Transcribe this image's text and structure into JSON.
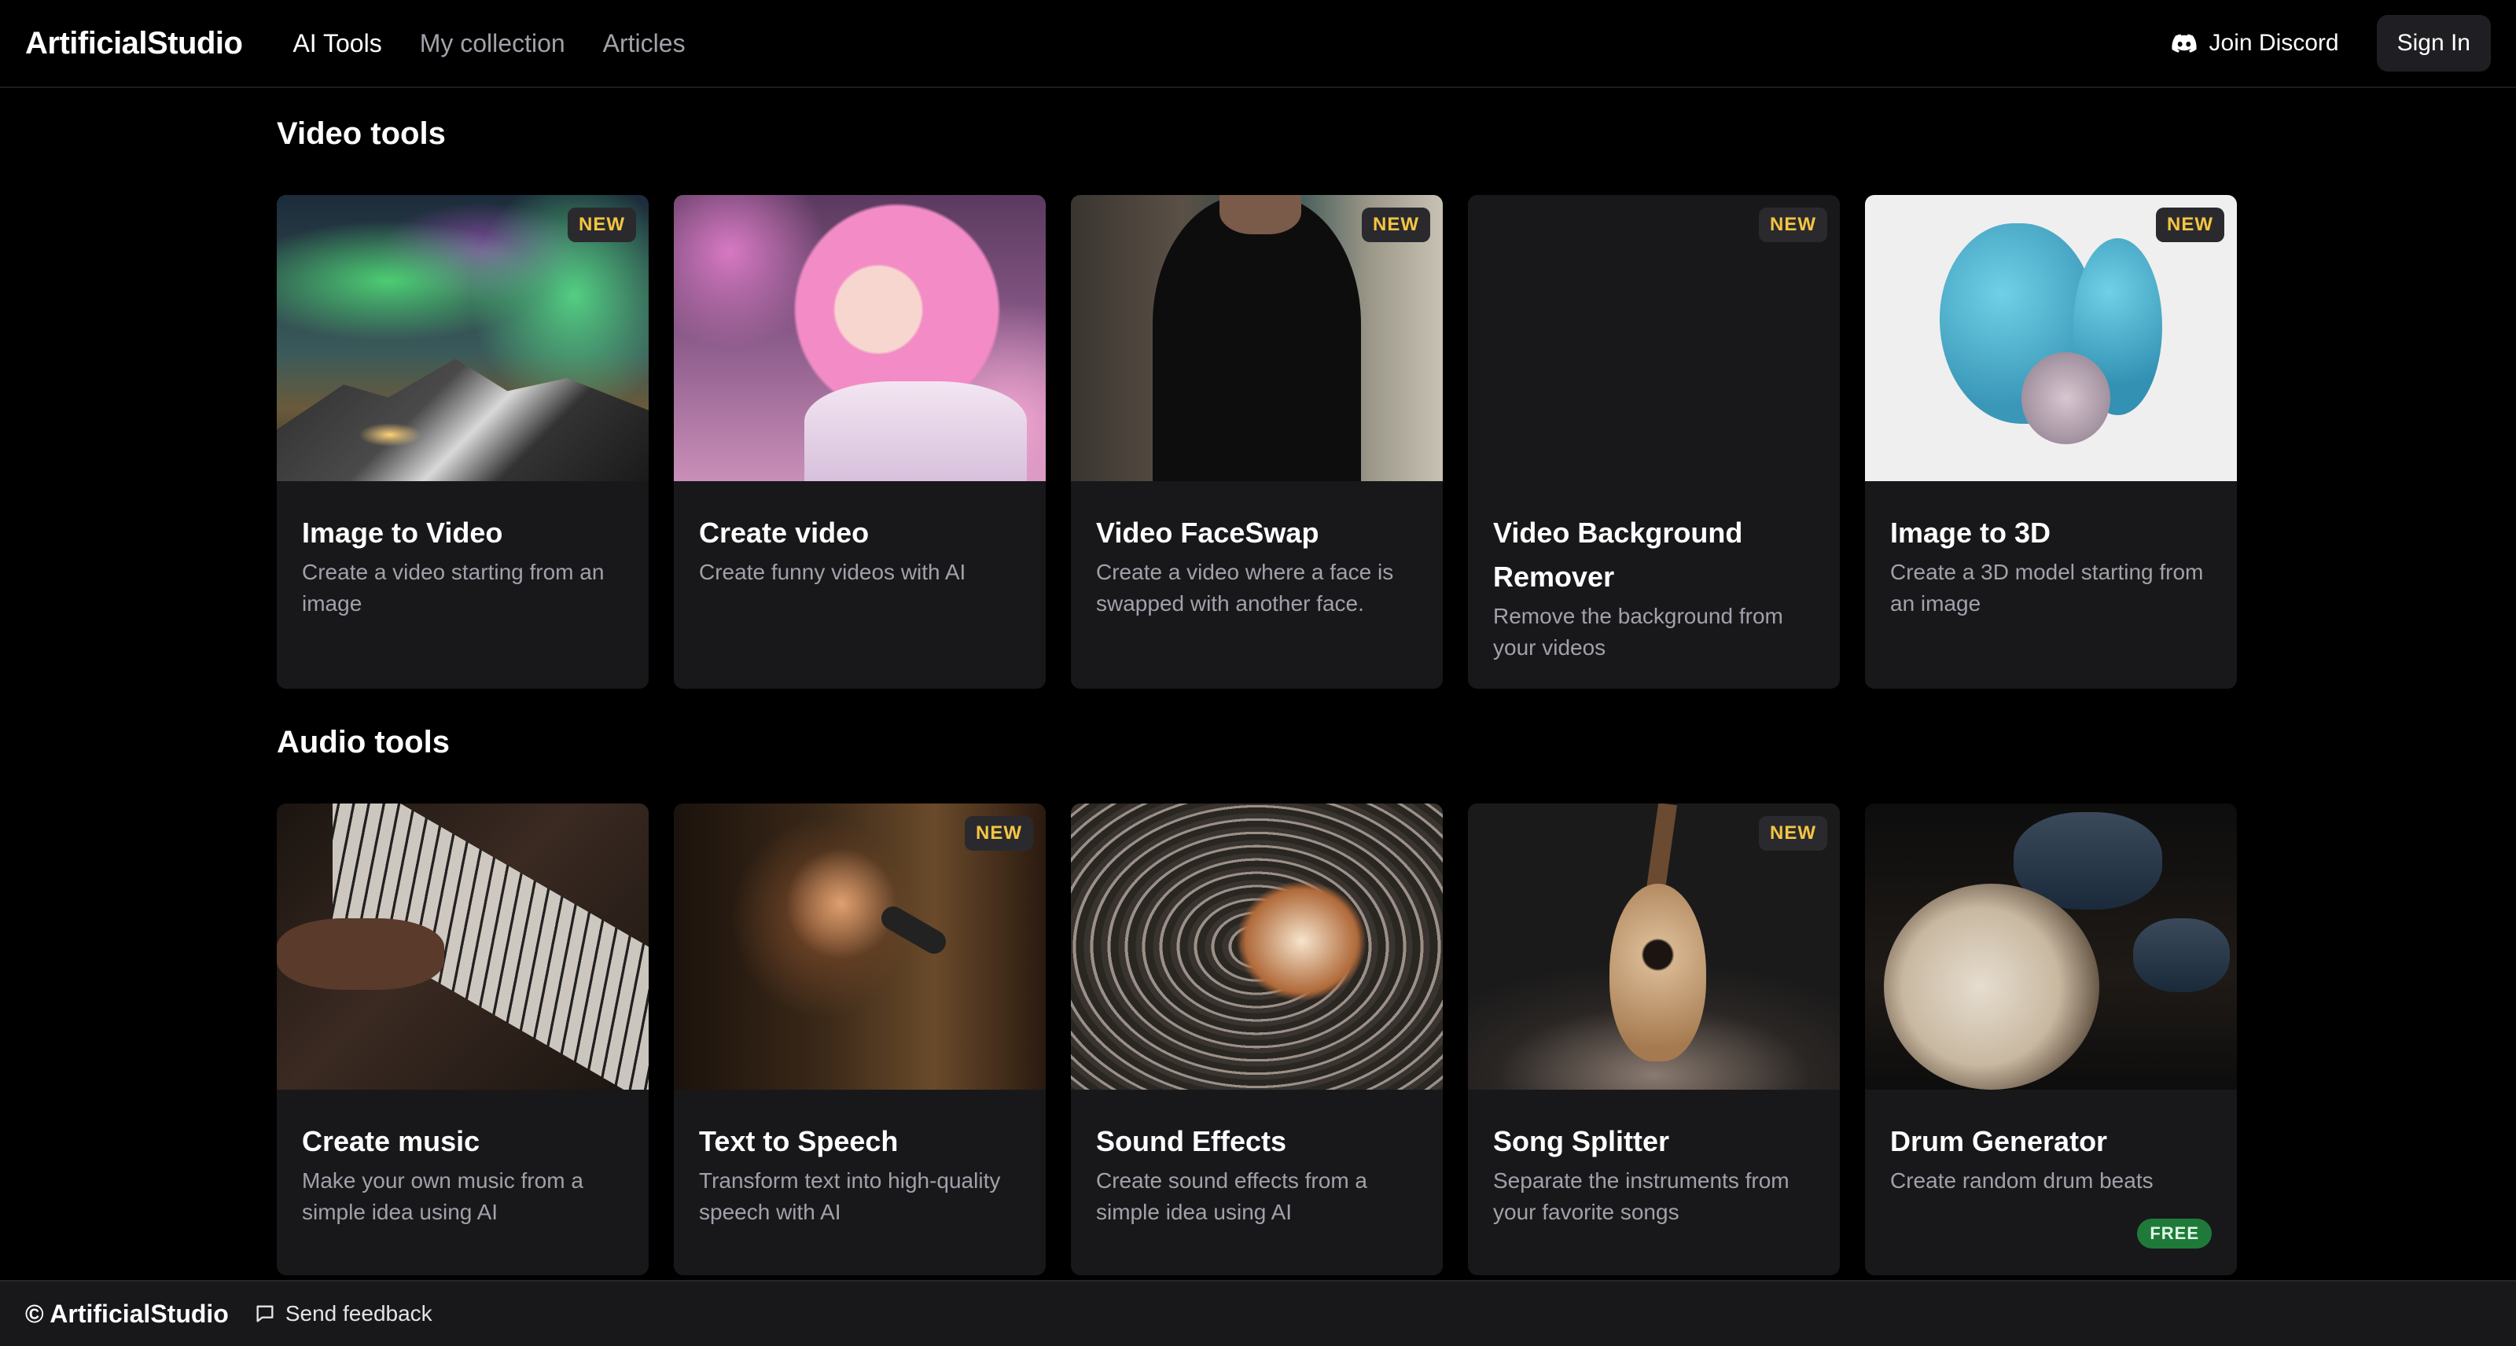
{
  "header": {
    "brand": "ArtificialStudio",
    "nav": [
      {
        "label": "AI Tools",
        "active": true
      },
      {
        "label": "My collection",
        "active": false
      },
      {
        "label": "Articles",
        "active": false
      }
    ],
    "discord_label": "Join Discord",
    "signin_label": "Sign In"
  },
  "sections": {
    "video": {
      "title": "Video tools",
      "cards": [
        {
          "title": "Image to Video",
          "desc": "Create a video starting from an image",
          "badge": "NEW"
        },
        {
          "title": "Create video",
          "desc": "Create funny videos with AI",
          "badge": ""
        },
        {
          "title": "Video FaceSwap",
          "desc": "Create a video where a face is swapped with another face.",
          "badge": "NEW"
        },
        {
          "title": "Video Background Remover",
          "desc": "Remove the background from your videos",
          "badge": "NEW"
        },
        {
          "title": "Image to 3D",
          "desc": "Create a 3D model starting from an image",
          "badge": "NEW"
        }
      ]
    },
    "audio": {
      "title": "Audio tools",
      "cards": [
        {
          "title": "Create music",
          "desc": "Make your own music from a simple idea using AI",
          "badge": ""
        },
        {
          "title": "Text to Speech",
          "desc": "Transform text into high-quality speech with AI",
          "badge": "NEW"
        },
        {
          "title": "Sound Effects",
          "desc": "Create sound effects from a simple idea using AI",
          "badge": ""
        },
        {
          "title": "Song Splitter",
          "desc": "Separate the instruments from your favorite songs",
          "badge": "NEW"
        },
        {
          "title": "Drum Generator",
          "desc": "Create random drum beats",
          "badge": "",
          "tag": "FREE"
        }
      ]
    }
  },
  "footer": {
    "copyright": "© ArtificialStudio",
    "feedback_label": "Send feedback"
  },
  "colors": {
    "background": "#000000",
    "card": "#18181b",
    "badge_text": "#f5c542",
    "free_badge": "#1f7a3a"
  },
  "icons": {
    "discord": "discord-icon",
    "feedback": "message-square-icon"
  }
}
